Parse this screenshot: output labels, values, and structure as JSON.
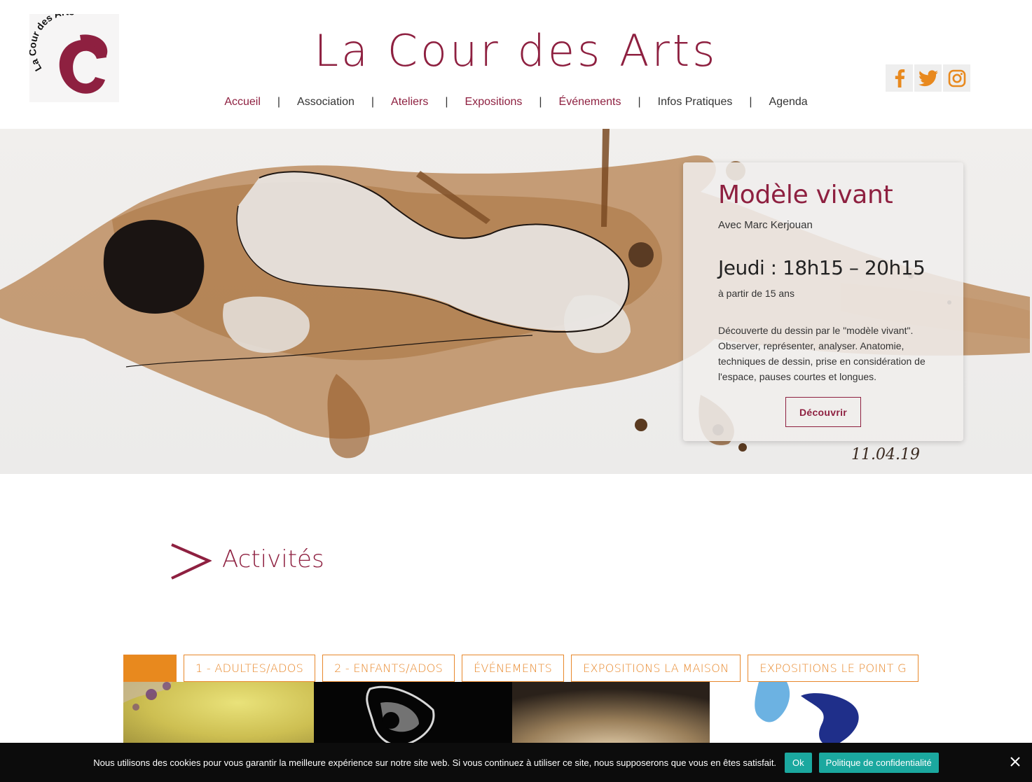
{
  "header": {
    "logo_text": "La Cour des Arts",
    "title": "La Cour des Arts",
    "nav": [
      "Accueil",
      "Association",
      "Ateliers",
      "Expositions",
      "Événements",
      "Infos Pratiques",
      "Agenda"
    ],
    "nav_separator": "|",
    "social": [
      "facebook-icon",
      "twitter-icon",
      "instagram-icon"
    ]
  },
  "hero": {
    "title": "Modèle vivant",
    "subtitle": "Avec Marc Kerjouan",
    "time": "Jeudi : 18h15 – 20h15",
    "age": "à partir de 15 ans",
    "description": "Découverte du dessin par le \"modèle vivant\". Observer, représenter, analyser. Anatomie, techniques de dessin, prise en considération de l'espace, pauses courtes et longues.",
    "button": "Découvrir",
    "signature": "11.04.19"
  },
  "activities": {
    "title": "Activités",
    "filters": [
      "",
      "1 - ADULTES/ADOS",
      "2 - ENFANTS/ADOS",
      "ÉVÉNEMENTS",
      "EXPOSITIONS LA MAISON",
      "EXPOSITIONS LE POINT G"
    ]
  },
  "cookie": {
    "text": "Nous utilisons des cookies pour vous garantir la meilleure expérience sur notre site web. Si vous continuez à utiliser ce site, nous supposerons que vous en êtes satisfait.",
    "ok": "Ok",
    "policy": "Politique de confidentialité"
  },
  "colors": {
    "brand": "#8e2040",
    "accent": "#e8891e",
    "cookie_button": "#1ba89f"
  }
}
